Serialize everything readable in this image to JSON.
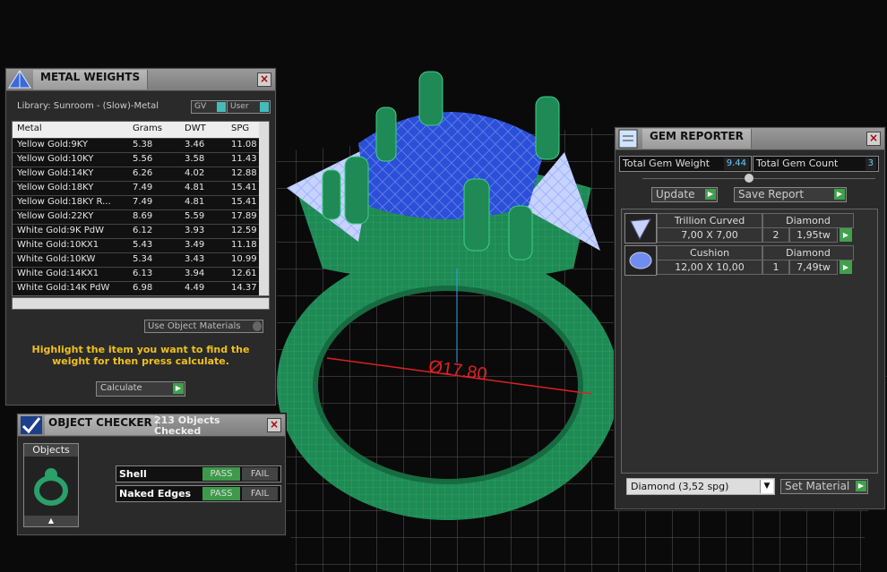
{
  "viewport": {
    "dimension": "Ø17.80"
  },
  "metal_weights": {
    "title": "METAL WEIGHTS",
    "library": "Library: Sunroom - (Slow)-Metal",
    "gv_label": "GV",
    "user_label": "User",
    "columns": [
      "Metal",
      "Grams",
      "DWT",
      "SPG"
    ],
    "rows": [
      [
        "Yellow Gold:9KY",
        "5.38",
        "3.46",
        "11.08"
      ],
      [
        "Yellow Gold:10KY",
        "5.56",
        "3.58",
        "11.43"
      ],
      [
        "Yellow Gold:14KY",
        "6.26",
        "4.02",
        "12.88"
      ],
      [
        "Yellow Gold:18KY",
        "7.49",
        "4.81",
        "15.41"
      ],
      [
        "Yellow Gold:18KY R...",
        "7.49",
        "4.81",
        "15.41"
      ],
      [
        "Yellow Gold:22KY",
        "8.69",
        "5.59",
        "17.89"
      ],
      [
        "White Gold:9K PdW",
        "6.12",
        "3.93",
        "12.59"
      ],
      [
        "White Gold:10KX1",
        "5.43",
        "3.49",
        "11.18"
      ],
      [
        "White Gold:10KW",
        "5.34",
        "3.43",
        "10.99"
      ],
      [
        "White Gold:14KX1",
        "6.13",
        "3.94",
        "12.61"
      ],
      [
        "White Gold:14K PdW",
        "6.98",
        "4.49",
        "14.37"
      ]
    ],
    "use_object_materials": "Use Object Materials",
    "note": "Highlight the item you want to find the weight for then press calculate.",
    "calculate_label": "Calculate"
  },
  "object_checker": {
    "title": "OBJECT CHECKER",
    "status": "213  Objects Checked",
    "objects_label": "Objects",
    "checks": [
      {
        "name": "Shell",
        "pass": "PASS",
        "fail": "FAIL"
      },
      {
        "name": "Naked Edges",
        "pass": "PASS",
        "fail": "FAIL"
      }
    ]
  },
  "gem_reporter": {
    "title": "GEM REPORTER",
    "total_weight_label": "Total Gem Weight",
    "total_weight_value": "9.44",
    "total_count_label": "Total Gem Count",
    "total_count_value": "3",
    "update_label": "Update",
    "save_report_label": "Save Report",
    "gems": [
      {
        "shape": "Trillion Curved",
        "material": "Diamond",
        "size": "7,00 X 7,00",
        "count": "2",
        "weight": "1,95tw"
      },
      {
        "shape": "Cushion",
        "material": "Diamond",
        "size": "12,00 X 10,00",
        "count": "1",
        "weight": "7,49tw"
      }
    ],
    "material_select": "Diamond     (3,52 spg)",
    "set_material_label": "Set Material"
  },
  "colors": {
    "ring": "#1f8a55",
    "gem_blue": "#2b4fd6",
    "accent_green": "#3fa14a",
    "note_yellow": "#f0c020",
    "dim_red": "#e02020"
  }
}
